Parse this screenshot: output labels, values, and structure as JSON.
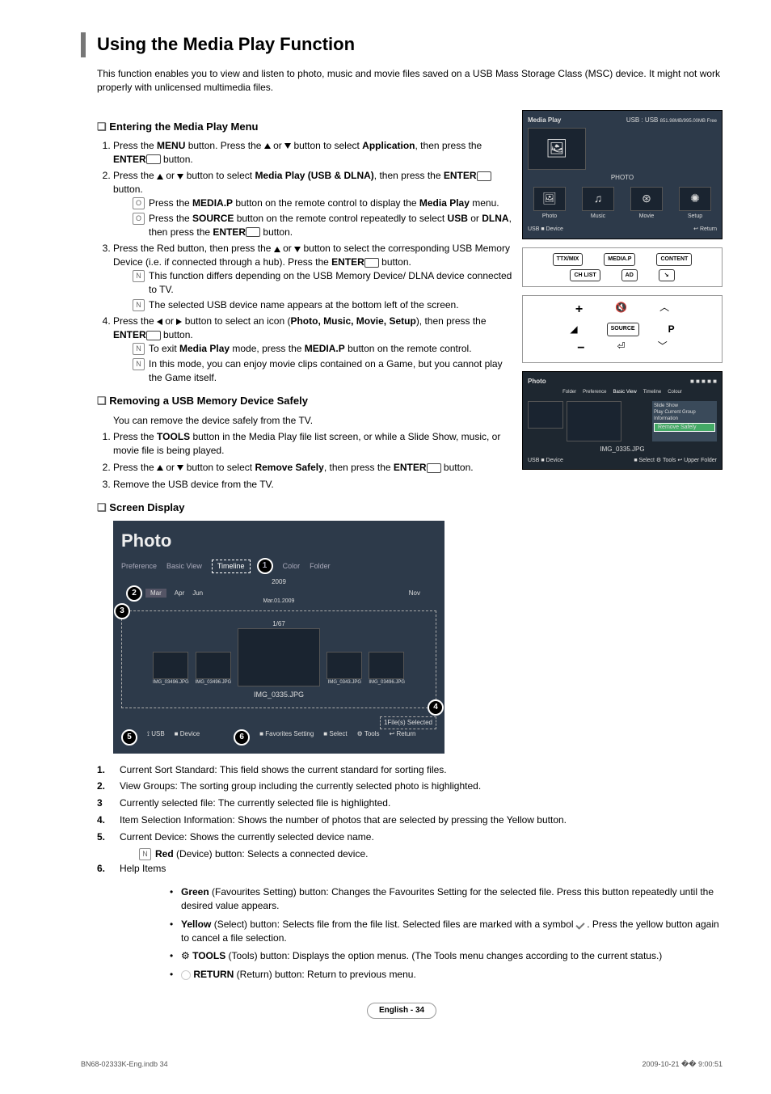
{
  "title": "Using the Media Play Function",
  "intro": "This function enables you to view and listen to photo, music and movie files saved on a USB Mass Storage Class (MSC) device. It might not work properly with unlicensed multimedia files.",
  "sec1": {
    "h": "Entering the Media Play Menu",
    "s1a": "Press the ",
    "s1b": "MENU",
    "s1c": " button. Press the ",
    "s1d": " or ",
    "s1e": " button to select ",
    "s1f": "Application",
    "s1g": ", then press the ",
    "s1h": "ENTER",
    "s1i": " button.",
    "s2a": "Press the ",
    "s2b": " or ",
    "s2c": " button to select ",
    "s2d": "Media Play (USB & DLNA)",
    "s2e": ", then press the ",
    "s2f": "ENTER",
    "s2g": " button.",
    "n1a": "Press the ",
    "n1b": "MEDIA.P",
    "n1c": " button on the remote control to display the ",
    "n1d": "Media Play",
    "n1e": " menu.",
    "n2a": "Press the ",
    "n2b": "SOURCE",
    "n2c": " button on the remote control repeatedly to select ",
    "n2d": "USB",
    "n2e": " or ",
    "n2f": "DLNA",
    "n2g": ", then press the ",
    "n2h": "ENTER",
    "n2i": " button.",
    "s3a": "Press the Red button, then press the ",
    "s3b": " or ",
    "s3c": " button to select the corresponding USB Memory Device (i.e. if connected through a hub). Press the ",
    "s3d": "ENTER",
    "s3e": " button.",
    "n3": "This function differs depending on the USB Memory Device/ DLNA device connected to TV.",
    "n4": "The selected USB device name appears at the bottom left of the screen.",
    "s4a": "Press the ",
    "s4b": " or ",
    "s4c": " button to select an icon (",
    "s4d": "Photo, Music, Movie, Setup",
    "s4e": "), then press the ",
    "s4f": "ENTER",
    "s4g": " button.",
    "n5a": "To exit ",
    "n5b": "Media Play",
    "n5c": " mode, press the ",
    "n5d": "MEDIA.P",
    "n5e": " button on the remote control.",
    "n6": "In this mode, you can enjoy movie clips contained on a Game, but you cannot play the Game itself."
  },
  "sec2": {
    "h": "Removing a USB Memory Device Safely",
    "p": "You can remove the device safely from the TV.",
    "s1a": "Press the ",
    "s1b": "TOOLS",
    "s1c": " button in the Media Play file list screen, or while a Slide Show, music, or movie file is being played.",
    "s2a": "Press the ",
    "s2b": " or ",
    "s2c": " button to select ",
    "s2d": "Remove Safely",
    "s2e": ", then press the ",
    "s2f": "ENTER",
    "s2g": " button.",
    "s3": "Remove the USB device from the TV."
  },
  "sec3": {
    "h": "Screen Display"
  },
  "ss1": {
    "title": "Media Play",
    "sub": "USB : USB",
    "free": "851.98MB/995.00MB Free",
    "big": "PHOTO",
    "t1": "Photo",
    "t2": "Music",
    "t3": "Movie",
    "t4": "Setup",
    "fL": "USB",
    "fL2": "Device",
    "fR": "Return"
  },
  "rem": {
    "b1": "TTX/MIX",
    "b2": "MEDIA.P",
    "b3": "CONTENT",
    "b4": "CH LIST",
    "b5": "AD",
    "b6": "SOURCE"
  },
  "ss2": {
    "title": "Photo",
    "tabs": [
      "Folder",
      "Preference",
      "Basic View",
      "Timeline",
      "Colour"
    ],
    "m1": "Slide Show",
    "m2": "Play Current Group",
    "m3": "Information",
    "m4": "Remove Safely",
    "fn": "IMG_0335.JPG",
    "fL": "USB",
    "fL2": "Device",
    "f1": "Select",
    "f2": "Tools",
    "f3": "Upper Folder"
  },
  "big": {
    "title": "Photo",
    "tabs": {
      "t1": "Preference",
      "t2": "Basic View",
      "t3": "Timeline",
      "t4": "Color",
      "t5": "Folder"
    },
    "yr": "2009",
    "mon": [
      "Mar",
      "Apr",
      "Jun",
      "Nov"
    ],
    "date": "Mar.01.2009",
    "count": "1/67",
    "th": [
      "IMG_03496.JPG",
      "IMG_03496.JPG",
      "IMG_0343.JPG",
      "IMG_03496.JPG"
    ],
    "fn": "IMG_0335.JPG",
    "sel": "1File(s) Selected",
    "fL": "USB",
    "fL2": "Device",
    "f1": "Favorites Setting",
    "f2": "Select",
    "f3": "Tools",
    "f4": "Return"
  },
  "leg": {
    "l1": "Current Sort Standard: This field shows the current standard for sorting files.",
    "l2": "View Groups: The sorting group including the currently selected photo is highlighted.",
    "l3": "Currently selected file: The currently selected file is highlighted.",
    "l4": "Item Selection Information: Shows the number of photos that are selected by pressing the Yellow button.",
    "l5": "Current Device: Shows the currently selected device name.",
    "l5nA": "Red",
    "l5nB": " (Device) button: Selects a connected device.",
    "l6": "Help Items",
    "h1a": "Green",
    "h1b": " (Favourites Setting) button: Changes the Favourites Setting for the selected file. Press this button repeatedly until the desired value appears.",
    "h2a": "Yellow",
    "h2b": " (Select) button: Selects file from the file list. Selected files are marked with a symbol ",
    "h2c": " . Press the yellow button again to cancel a file selection.",
    "h3a": "TOOLS",
    "h3b": " (Tools) button: Displays the option menus. (The Tools menu changes according to the current status.)",
    "h4a": "RETURN",
    "h4b": " (Return) button: Return to previous menu."
  },
  "page": "English - 34",
  "foot": {
    "l": "BN68-02333K-Eng.indb   34",
    "r": "2009-10-21   �� 9:00:51"
  }
}
